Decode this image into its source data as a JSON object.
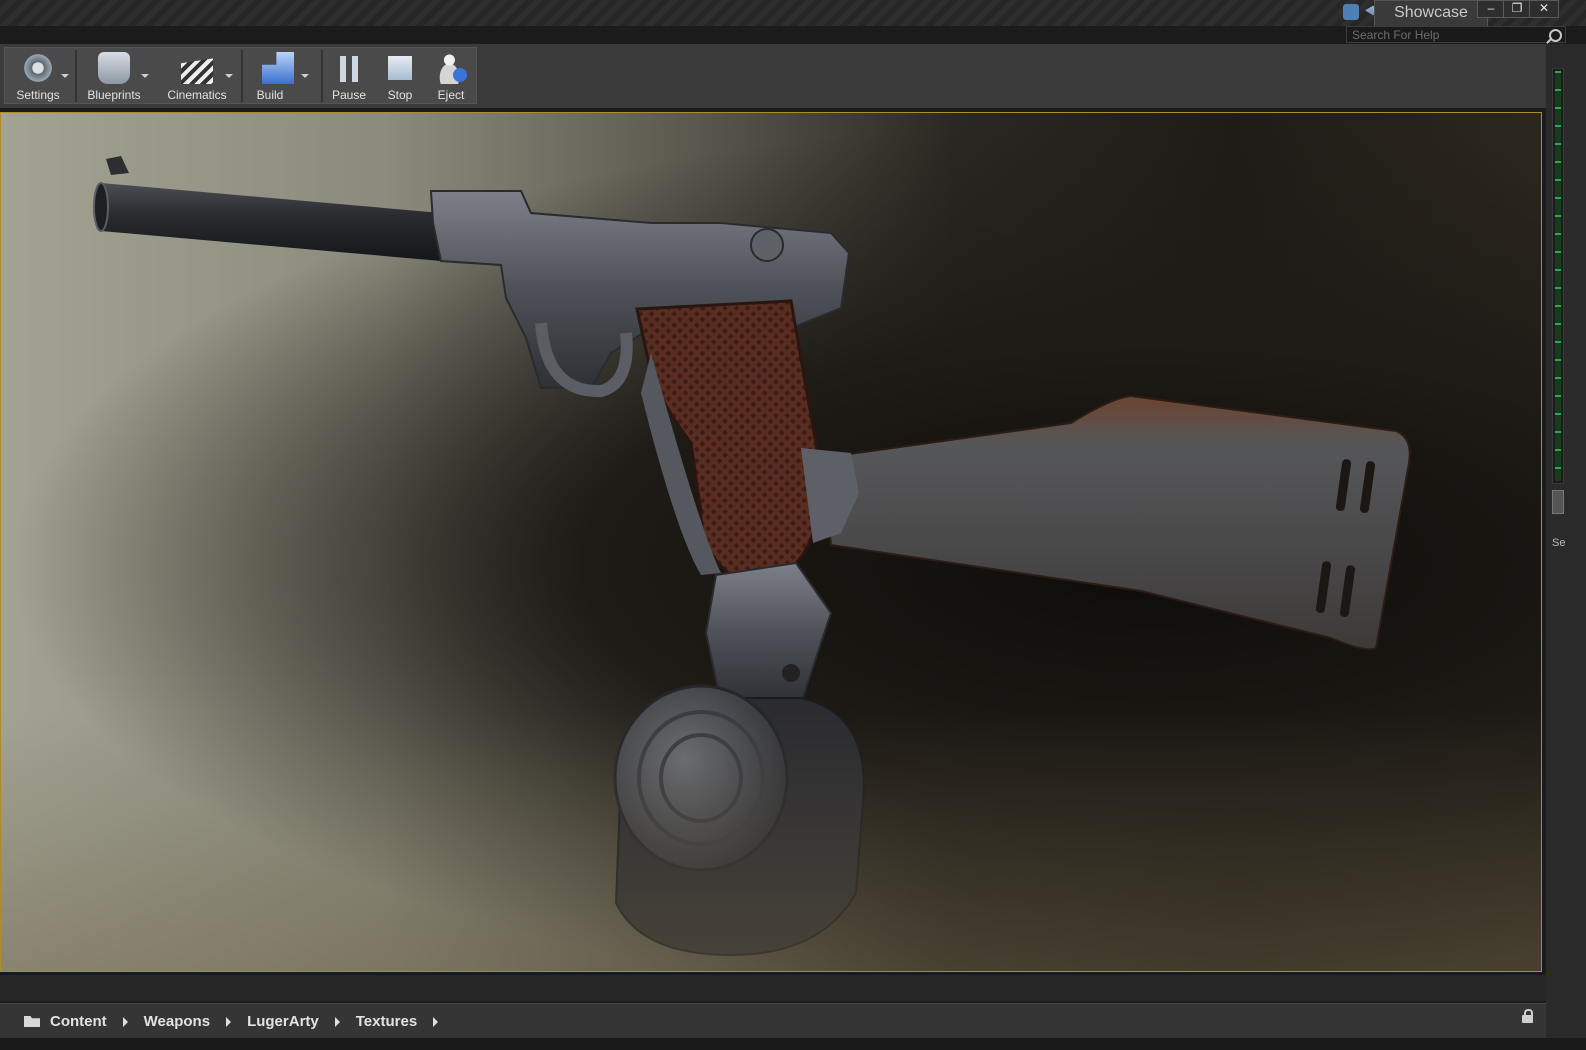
{
  "window": {
    "project_tab": "Showcase",
    "search_placeholder": "Search For Help",
    "controls": [
      "–",
      "❐",
      "✕"
    ]
  },
  "toolbar": {
    "buttons": [
      {
        "label": "Settings",
        "icon": "settings-icon",
        "has_dropdown": true
      },
      {
        "label": "Blueprints",
        "icon": "blueprints-icon",
        "has_dropdown": true
      },
      {
        "label": "Cinematics",
        "icon": "cinematics-icon",
        "has_dropdown": true
      },
      {
        "label": "Build",
        "icon": "build-icon",
        "has_dropdown": true
      },
      {
        "label": "Pause",
        "icon": "pause-icon",
        "has_dropdown": false
      },
      {
        "label": "Stop",
        "icon": "stop-icon",
        "has_dropdown": false
      },
      {
        "label": "Eject",
        "icon": "eject-icon",
        "has_dropdown": false
      }
    ]
  },
  "viewport": {
    "subject": "weapon-model",
    "border_color": "#b08a2b"
  },
  "side_panel": {
    "label": "Se"
  },
  "content_browser": {
    "breadcrumb": [
      "Content",
      "Weapons",
      "LugerArty",
      "Textures"
    ]
  },
  "colors": {
    "accent": "#b08a2b",
    "meter": "#2ea84d"
  }
}
